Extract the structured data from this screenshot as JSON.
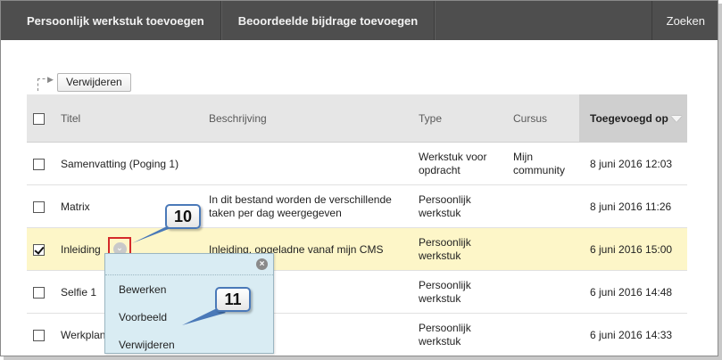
{
  "topbar": {
    "items": [
      "Persoonlijk werkstuk toevoegen",
      "Beoordeelde bijdrage toevoegen"
    ],
    "search_label": "Zoeken"
  },
  "toolbar": {
    "delete_label": "Verwijderen"
  },
  "table": {
    "headers": {
      "title": "Titel",
      "description": "Beschrijving",
      "type": "Type",
      "course": "Cursus",
      "added": "Toegevoegd op"
    },
    "rows": [
      {
        "title": "Samenvatting (Poging 1)",
        "description": "",
        "type": "Werkstuk voor opdracht",
        "course": "Mijn community",
        "date": "8 juni 2016 12:03",
        "checked": false
      },
      {
        "title": "Matrix",
        "description": "In dit bestand worden de verschillende taken per dag weergegeven",
        "type": "Persoonlijk werkstuk",
        "course": "",
        "date": "8 juni 2016 11:26",
        "checked": false
      },
      {
        "title": "Inleiding",
        "description": "Inleiding, opgeladne vanaf mijn CMS",
        "type": "Persoonlijk werkstuk",
        "course": "",
        "date": "6 juni 2016 15:00",
        "checked": true
      },
      {
        "title": "Selfie 1",
        "description": "",
        "type": "Persoonlijk werkstuk",
        "course": "",
        "date": "6 juni 2016 14:48",
        "checked": false
      },
      {
        "title": "Werkplan",
        "description": "",
        "type": "Persoonlijk werkstuk",
        "course": "",
        "date": "6 juni 2016 14:33",
        "checked": false
      }
    ]
  },
  "context_menu": {
    "items": [
      "Bewerken",
      "Voorbeeld",
      "Verwijderen"
    ]
  },
  "callouts": {
    "first": "10",
    "second": "11"
  },
  "colors": {
    "topbar": "#4e4e4e",
    "selected_row": "#fdf6c8",
    "menu_bg": "#d9ecf3",
    "callout_border": "#4a79b8",
    "highlight_red": "#d42a2a"
  }
}
